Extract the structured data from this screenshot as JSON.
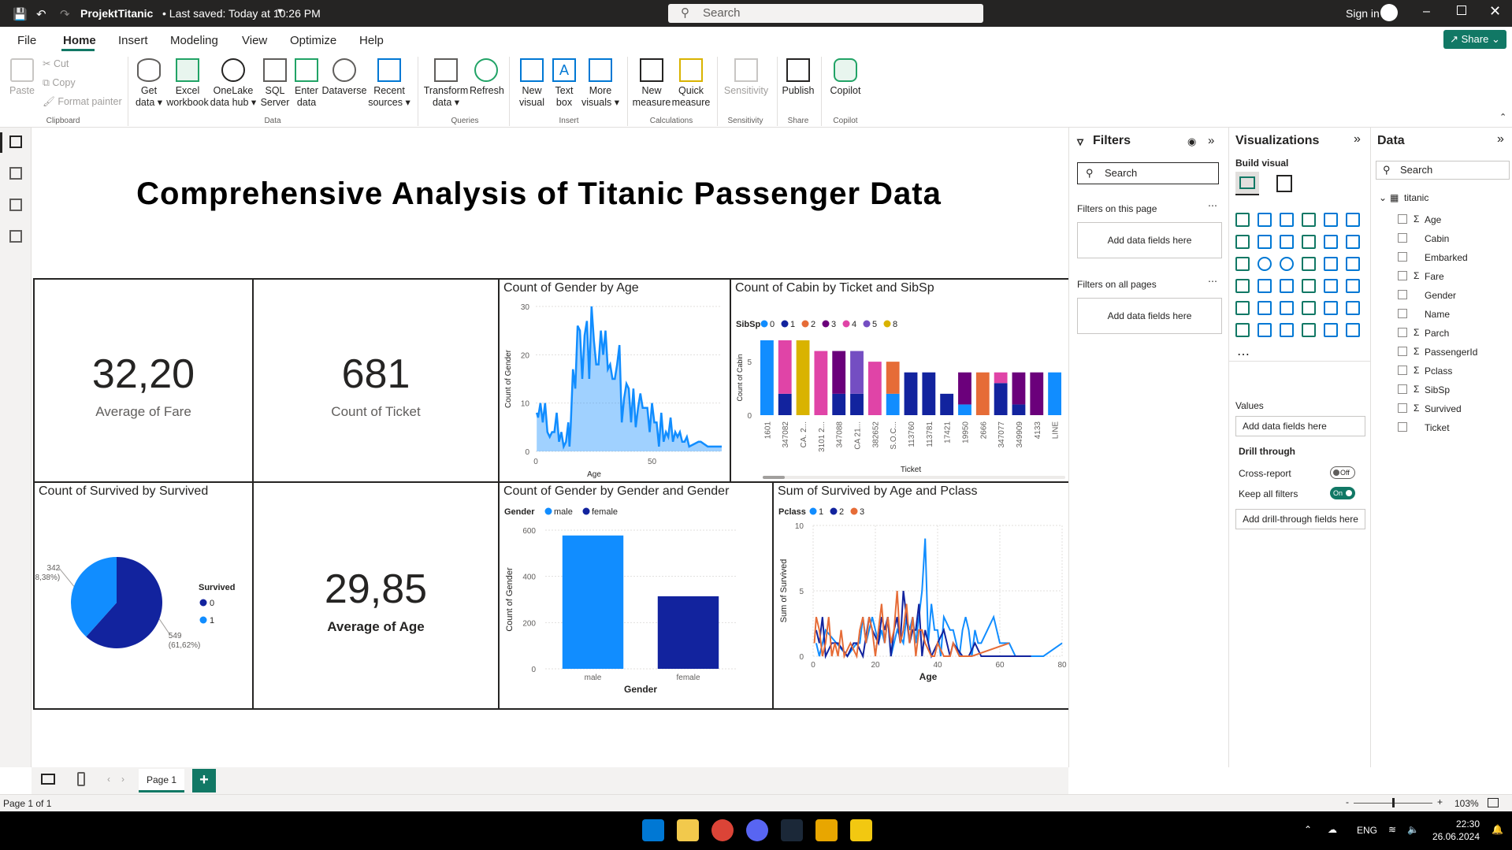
{
  "titlebar": {
    "doc_title": "ProjektTitanic",
    "saved": "• Last saved: Today at 10:26 PM",
    "search_placeholder": "Search",
    "sign_in": "Sign in"
  },
  "menu": {
    "tabs": [
      "File",
      "Home",
      "Insert",
      "Modeling",
      "View",
      "Optimize",
      "Help"
    ],
    "share": "Share"
  },
  "ribbon": {
    "clipboard": {
      "paste": "Paste",
      "cut": "Cut",
      "copy": "Copy",
      "format_painter": "Format painter",
      "group": "Clipboard"
    },
    "data": {
      "get_data": "Get data ▾",
      "excel": "Excel workbook",
      "onelake": "OneLake data hub ▾",
      "sql": "SQL Server",
      "enter": "Enter data",
      "dataverse": "Dataverse",
      "recent": "Recent sources ▾",
      "group": "Data"
    },
    "queries": {
      "transform": "Transform data ▾",
      "refresh": "Refresh",
      "group": "Queries"
    },
    "insert": {
      "new_visual": "New visual",
      "text_box": "Text box",
      "more_visuals": "More visuals ▾",
      "group": "Insert"
    },
    "calculations": {
      "new_measure": "New measure",
      "quick_measure": "Quick measure",
      "group": "Calculations"
    },
    "sensitivity": {
      "label": "Sensitivity",
      "group": "Sensitivity"
    },
    "share": {
      "publish": "Publish",
      "group": "Share"
    },
    "copilot": {
      "label": "Copilot",
      "group": "Copilot"
    }
  },
  "report": {
    "title": "Comprehensive Analysis of Titanic Passenger Data",
    "kpi_fare": {
      "value": "32,20",
      "label": "Average of Fare"
    },
    "kpi_ticket": {
      "value": "681",
      "label": "Count of Ticket"
    },
    "kpi_age": {
      "value": "29,85",
      "label": "Average of Age"
    },
    "area_title": "Count of Gender by Age",
    "cabin_title": "Count of Cabin by Ticket and SibSp",
    "pie_title": "Count of Survived by Survived",
    "gender_title": "Count of Gender by Gender and Gender",
    "line_title": "Sum of Survived by Age and Pclass"
  },
  "chart_data": [
    {
      "type": "area",
      "title": "Count of Gender by Age",
      "xlabel": "Age",
      "ylabel": "Count of Gender",
      "xlim": [
        0,
        80
      ],
      "ylim": [
        0,
        30
      ],
      "x_ticks": [
        "0",
        "50"
      ],
      "y_ticks": [
        "0",
        "10",
        "20",
        "30"
      ],
      "color": "#118dff",
      "x": [
        0.4,
        1,
        2,
        3,
        4,
        5,
        6,
        7,
        8,
        9,
        10,
        11,
        12,
        13,
        14,
        14.5,
        15,
        16,
        17,
        18,
        19,
        20,
        21,
        22,
        23,
        24,
        25,
        26,
        27,
        28,
        29,
        30,
        31,
        32,
        33,
        34,
        35,
        36,
        37,
        38,
        39,
        40,
        41,
        42,
        43,
        44,
        45,
        46,
        47,
        48,
        49,
        50,
        51,
        52,
        53,
        54,
        55,
        56,
        57,
        58,
        59,
        60,
        61,
        62,
        63,
        64,
        65,
        66,
        70,
        71,
        74,
        80
      ],
      "y": [
        8,
        7,
        10,
        6,
        10,
        4,
        3,
        4,
        4,
        8,
        2,
        4,
        1,
        2,
        6,
        1,
        5,
        17,
        13,
        26,
        25,
        15,
        24,
        27,
        15,
        30,
        23,
        18,
        18,
        25,
        20,
        25,
        17,
        18,
        15,
        15,
        18,
        22,
        6,
        11,
        14,
        13,
        6,
        13,
        5,
        9,
        12,
        9,
        9,
        9,
        4,
        10,
        6,
        6,
        1,
        8,
        2,
        4,
        3,
        7,
        2,
        4,
        3,
        4,
        2,
        2,
        3,
        1,
        2,
        2,
        1,
        1
      ]
    },
    {
      "type": "stacked-bar",
      "title": "Count of Cabin by Ticket and SibSp",
      "xlabel": "Ticket",
      "ylabel": "Count of Cabin",
      "ylim": [
        0,
        7
      ],
      "y_ticks": [
        "0",
        "5"
      ],
      "legend_title": "SibSp",
      "categories": [
        "1601",
        "347082",
        "CA. 2...",
        "3101 2...",
        "347088",
        "CA 21...",
        "382652",
        "S.O.C...",
        "113760",
        "113781",
        "17421",
        "19950",
        "2666",
        "347077",
        "349909",
        "4133",
        "LINE"
      ],
      "series": [
        {
          "name": "0",
          "color": "#118dff",
          "values": [
            7,
            0,
            0,
            0,
            0,
            0,
            0,
            2,
            0,
            0,
            0,
            1,
            0,
            0,
            0,
            0,
            4
          ]
        },
        {
          "name": "1",
          "color": "#12239e",
          "values": [
            0,
            2,
            0,
            0,
            2,
            2,
            0,
            0,
            4,
            4,
            2,
            0,
            0,
            3,
            1,
            0,
            0
          ]
        },
        {
          "name": "2",
          "color": "#e66c37",
          "values": [
            0,
            0,
            0,
            0,
            0,
            0,
            0,
            3,
            0,
            0,
            0,
            0,
            4,
            0,
            0,
            0,
            0
          ]
        },
        {
          "name": "3",
          "color": "#6b007b",
          "values": [
            0,
            0,
            0,
            0,
            4,
            0,
            0,
            0,
            0,
            0,
            0,
            3,
            0,
            0,
            3,
            4,
            0
          ]
        },
        {
          "name": "4",
          "color": "#e044a7",
          "values": [
            0,
            5,
            0,
            6,
            0,
            0,
            5,
            0,
            0,
            0,
            0,
            0,
            0,
            1,
            0,
            0,
            0
          ]
        },
        {
          "name": "5",
          "color": "#744ec2",
          "values": [
            0,
            0,
            0,
            0,
            0,
            4,
            0,
            0,
            0,
            0,
            0,
            0,
            0,
            0,
            0,
            0,
            0
          ]
        },
        {
          "name": "8",
          "color": "#d9b300",
          "values": [
            0,
            0,
            7,
            0,
            0,
            0,
            0,
            0,
            0,
            0,
            0,
            0,
            0,
            0,
            0,
            0,
            0
          ]
        }
      ]
    },
    {
      "type": "pie",
      "title": "Count of Survived by Survived",
      "legend_title": "Survived",
      "slices": [
        {
          "label": "0",
          "value": 549,
          "pct": "(61,62%)",
          "color": "#12239e"
        },
        {
          "label": "1",
          "value": 342,
          "pct": "(38,38%)",
          "color": "#118dff"
        }
      ]
    },
    {
      "type": "bar",
      "title": "Count of Gender by Gender and Gender",
      "xlabel": "Gender",
      "ylabel": "Count of Gender",
      "legend_title": "Gender",
      "ylim": [
        0,
        600
      ],
      "y_ticks": [
        "0",
        "200",
        "400",
        "600"
      ],
      "categories": [
        "male",
        "female"
      ],
      "values": [
        577,
        314
      ],
      "colors": [
        "#118dff",
        "#12239e"
      ]
    },
    {
      "type": "line",
      "title": "Sum of Survived by Age and Pclass",
      "xlabel": "Age",
      "ylabel": "Sum of Survived",
      "legend_title": "Pclass",
      "xlim": [
        0,
        80
      ],
      "ylim": [
        0,
        10
      ],
      "x_ticks": [
        "0",
        "20",
        "40",
        "60",
        "80"
      ],
      "y_ticks": [
        "0",
        "5",
        "10"
      ],
      "series": [
        {
          "name": "1",
          "color": "#118dff",
          "x": [
            1,
            2,
            4,
            11,
            14,
            15,
            16,
            17,
            18,
            19,
            21,
            22,
            23,
            24,
            25,
            27,
            29,
            30,
            31,
            32,
            33,
            35,
            36,
            37,
            38,
            39,
            40,
            41,
            42,
            44,
            45,
            47,
            48,
            49,
            50,
            51,
            52,
            53,
            54,
            56,
            58,
            60,
            62,
            63,
            65,
            70,
            71,
            74,
            80
          ],
          "y": [
            1,
            0,
            2,
            0,
            1,
            1,
            3,
            1,
            2,
            3,
            1,
            2,
            1,
            3,
            0,
            2,
            1,
            3,
            2,
            3,
            1,
            5,
            9,
            1,
            4,
            2,
            2,
            0,
            3,
            2,
            2,
            0,
            2,
            3,
            2,
            0,
            2,
            1,
            1,
            2,
            3,
            1,
            1,
            1,
            0,
            0,
            0,
            0,
            1
          ]
        },
        {
          "name": "2",
          "color": "#12239e",
          "x": [
            1,
            2,
            3,
            4,
            6,
            8,
            11,
            13,
            14,
            16,
            18,
            19,
            21,
            22,
            23,
            24,
            25,
            26,
            27,
            28,
            29,
            30,
            31,
            32,
            33,
            34,
            35,
            36,
            37,
            38,
            40,
            42,
            44,
            45,
            48,
            50,
            52,
            54,
            57,
            60,
            62,
            66,
            70
          ],
          "y": [
            2,
            1,
            3,
            0,
            1,
            1,
            0,
            1,
            1,
            0,
            3,
            2,
            1,
            3,
            2,
            3,
            0,
            2,
            3,
            1,
            5,
            3,
            1,
            2,
            2,
            4,
            0,
            2,
            1,
            0,
            1,
            2,
            0,
            1,
            0,
            0,
            1,
            0,
            0,
            0,
            0,
            0,
            0
          ]
        },
        {
          "name": "3",
          "color": "#e66c37",
          "x": [
            0.4,
            1,
            2,
            3,
            4,
            5,
            6,
            7,
            8,
            9,
            10,
            12,
            14,
            15,
            16,
            17,
            18,
            19,
            20,
            21,
            22,
            23,
            24,
            25,
            26,
            27,
            28,
            29,
            30,
            31,
            32,
            33,
            34,
            35,
            36,
            38,
            39,
            40,
            42,
            43,
            44,
            45,
            47,
            51,
            63
          ],
          "y": [
            1,
            3,
            2,
            0,
            1,
            3,
            0,
            1,
            0,
            2,
            0,
            1,
            0,
            2,
            3,
            1,
            3,
            2,
            0,
            2,
            4,
            1,
            3,
            1,
            2,
            5,
            1,
            2,
            4,
            1,
            3,
            0,
            2,
            2,
            1,
            0,
            0,
            1,
            0,
            0,
            0,
            1,
            0,
            0,
            1
          ]
        }
      ]
    }
  ],
  "filters": {
    "title": "Filters",
    "search": "Search",
    "on_page": "Filters on this page",
    "on_all": "Filters on all pages",
    "add_here": "Add data fields here"
  },
  "viz": {
    "title": "Visualizations",
    "build": "Build visual",
    "values": "Values",
    "add_here": "Add data fields here",
    "drill": "Drill through",
    "cross": "Cross-report",
    "cross_state": "Off",
    "keep": "Keep all filters",
    "keep_state": "On",
    "add_drill": "Add drill-through fields here"
  },
  "datapane": {
    "title": "Data",
    "search": "Search",
    "table": "titanic",
    "fields": [
      {
        "name": "Age",
        "sigma": true
      },
      {
        "name": "Cabin",
        "sigma": false
      },
      {
        "name": "Embarked",
        "sigma": false
      },
      {
        "name": "Fare",
        "sigma": true
      },
      {
        "name": "Gender",
        "sigma": false
      },
      {
        "name": "Name",
        "sigma": false
      },
      {
        "name": "Parch",
        "sigma": true
      },
      {
        "name": "PassengerId",
        "sigma": true
      },
      {
        "name": "Pclass",
        "sigma": true
      },
      {
        "name": "SibSp",
        "sigma": true
      },
      {
        "name": "Survived",
        "sigma": true
      },
      {
        "name": "Ticket",
        "sigma": false
      }
    ]
  },
  "pages": {
    "page1": "Page 1",
    "add": "+"
  },
  "status": {
    "page": "Page 1 of 1",
    "zoom": "103%",
    "minus": "-",
    "plus": "+"
  },
  "taskbar": {
    "lang": "ENG",
    "time": "22:30",
    "date": "26.06.2024"
  }
}
